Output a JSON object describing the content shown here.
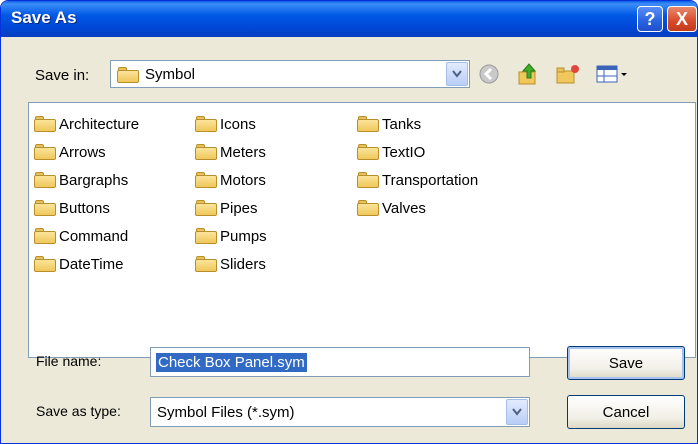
{
  "window": {
    "title": "Save As"
  },
  "title_buttons": {
    "help": "?",
    "close": "X"
  },
  "save_in": {
    "label": "Save in:",
    "value": "Symbol"
  },
  "toolbar_icons": [
    "back-icon",
    "up-folder-icon",
    "new-folder-icon",
    "views-menu-icon"
  ],
  "folders": {
    "col1": [
      "Architecture",
      "Arrows",
      "Bargraphs",
      "Buttons",
      "Command",
      "DateTime"
    ],
    "col2": [
      "Icons",
      "Meters",
      "Motors",
      "Pipes",
      "Pumps",
      "Sliders"
    ],
    "col3": [
      "Tanks",
      "TextIO",
      "Transportation",
      "Valves"
    ]
  },
  "file_name": {
    "label": "File name:",
    "value": "Check Box Panel.sym"
  },
  "save_as_type": {
    "label": "Save as type:",
    "value": "Symbol Files (*.sym)"
  },
  "buttons": {
    "save": "Save",
    "cancel": "Cancel"
  },
  "colors": {
    "titlebar": "#0058e6",
    "selection": "#316ac5",
    "dialog_bg": "#ece9d8"
  }
}
